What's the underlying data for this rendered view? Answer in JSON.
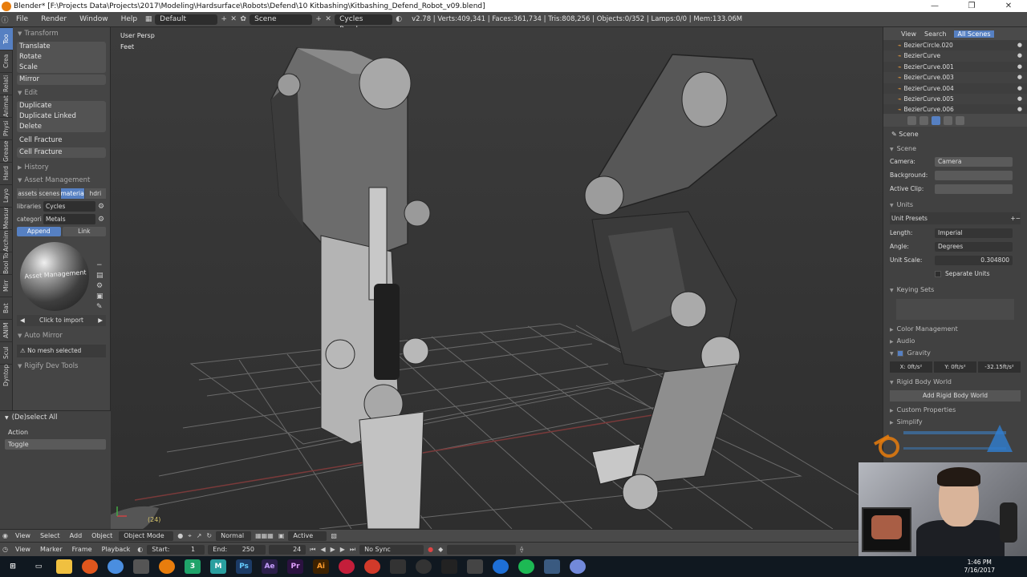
{
  "window": {
    "title": "Blender* [F:\\Projects Data\\Projects\\2017\\Modeling\\Hardsurface\\Robots\\Defend\\10 Kitbashing\\Kitbashing_Defend_Robot_v09.blend]",
    "minimize": "—",
    "maximize": "❐",
    "close": "✕"
  },
  "infobar": {
    "menus": [
      "File",
      "Render",
      "Window",
      "Help"
    ],
    "layout": "Default",
    "scene": "Scene",
    "engine": "Cycles Render",
    "stats": "v2.78 | Verts:409,341 | Faces:361,734 | Tris:808,256 | Objects:0/352 | Lamps:0/0 | Mem:133.06M"
  },
  "tabs": [
    "Too",
    "Crea",
    "Relati",
    "Animati",
    "Physi",
    "Grease Pe",
    "Hard",
    "Layo",
    "Measur",
    "Archim",
    "Bool To",
    "Mirr",
    "Bat",
    "ANIM",
    "Scul",
    "Dyntopo"
  ],
  "toolshelf": {
    "transform_title": "Transform",
    "translate": "Translate",
    "rotate": "Rotate",
    "scale": "Scale",
    "mirror": "Mirror",
    "edit_title": "Edit",
    "duplicate": "Duplicate",
    "duplicate_linked": "Duplicate Linked",
    "delete": "Delete",
    "cell_fracture_1": "Cell Fracture",
    "cell_fracture_2": "Cell Fracture",
    "history": "History",
    "asset_management": "Asset Management",
    "am_tabs": [
      "assets",
      "scenes",
      "materia",
      "hdri"
    ],
    "libraries_label": "libraries",
    "libraries_value": "Cycles",
    "category_label": "categori",
    "category_value": "Metals",
    "append": "Append",
    "link": "Link",
    "thumb_label": "Asset Management",
    "click_to_import": "Click to import",
    "auto_mirror": "Auto Mirror",
    "no_mesh": "No mesh selected",
    "rigify": "Rigify Dev Tools"
  },
  "operator": {
    "title": "(De)select All",
    "action_label": "Action",
    "action_value": "Toggle"
  },
  "viewport": {
    "view_name": "User Persp",
    "units": "Feet",
    "frame": "(24)"
  },
  "outliner": {
    "tabs": [
      "View",
      "Search",
      "All Scenes"
    ],
    "items": [
      "BezierCircle.020",
      "BezierCurve",
      "BezierCurve.001",
      "BezierCurve.003",
      "BezierCurve.004",
      "BezierCurve.005",
      "BezierCurve.006"
    ]
  },
  "properties": {
    "crumb": "Scene",
    "scene_section": "Scene",
    "camera_label": "Camera:",
    "camera_value": "Camera",
    "background_label": "Background:",
    "active_clip_label": "Active Clip:",
    "units_section": "Units",
    "unit_presets": "Unit Presets",
    "length_label": "Length:",
    "length_value": "Imperial",
    "angle_label": "Angle:",
    "angle_value": "Degrees",
    "unit_scale_label": "Unit Scale:",
    "unit_scale_value": "0.304800",
    "separate_units": "Separate Units",
    "keying_sets": "Keying Sets",
    "color_management": "Color Management",
    "audio": "Audio",
    "gravity": "Gravity",
    "gravity_x": "X:  0ft/s²",
    "gravity_y": "Y:  0ft/s²",
    "gravity_z": "-32.15ft/s²",
    "rigid_body_world": "Rigid Body World",
    "add_rigid_body_world": "Add Rigid Body World",
    "custom_properties": "Custom Properties",
    "simplify": "Simplify"
  },
  "viewheader": {
    "view": "View",
    "select": "Select",
    "add": "Add",
    "object": "Object",
    "mode": "Object Mode",
    "orientation": "Normal",
    "active": "Active"
  },
  "timeline": {
    "view": "View",
    "marker": "Marker",
    "frame": "Frame",
    "playback": "Playback",
    "start_label": "Start:",
    "start_value": "1",
    "end_label": "End:",
    "end_value": "250",
    "current": "24",
    "sync": "No Sync"
  },
  "taskbar": {
    "time": "1:46 PM",
    "date": "7/16/2017"
  },
  "colors": {
    "accent": "#5680c2",
    "blender_orange": "#e87d0d"
  }
}
